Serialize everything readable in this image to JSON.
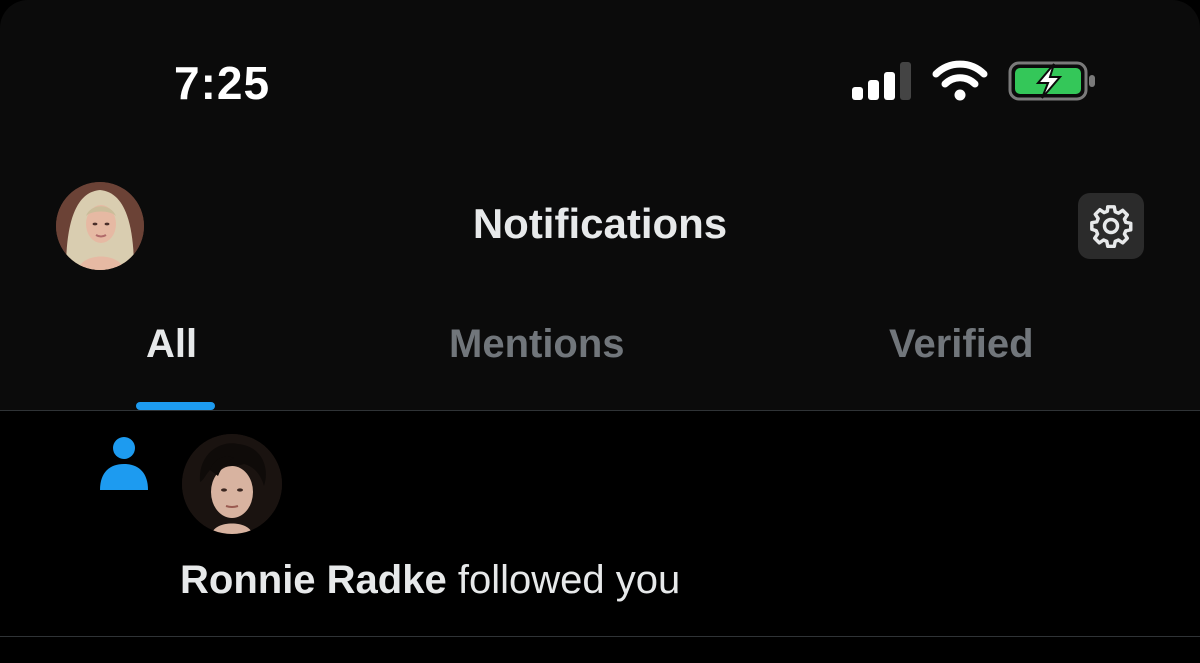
{
  "status_bar": {
    "time": "7:25",
    "signal_icon": "cellular-signal-icon",
    "wifi_icon": "wifi-icon",
    "battery_icon": "battery-charging-icon",
    "battery_color": "#34c759"
  },
  "header": {
    "title": "Notifications",
    "avatar_icon": "profile-avatar",
    "settings_icon": "gear-icon"
  },
  "tabs": [
    {
      "label": "All",
      "active": true
    },
    {
      "label": "Mentions",
      "active": false
    },
    {
      "label": "Verified",
      "active": false
    }
  ],
  "accent_color": "#1d9bf0",
  "notifications": [
    {
      "type_icon": "person-follow-icon",
      "user_name": "Ronnie Radke",
      "action_text": "followed you"
    }
  ]
}
